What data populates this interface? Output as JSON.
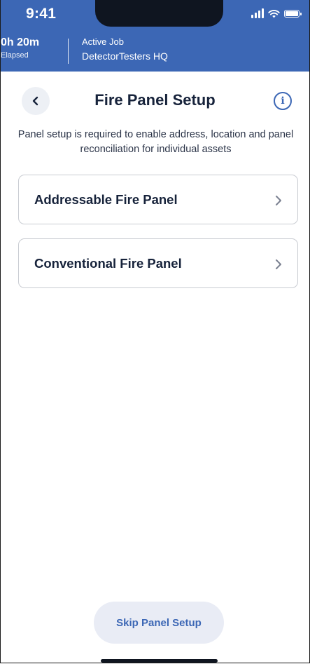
{
  "status_bar": {
    "time": "9:41",
    "icons": [
      "signal-icon",
      "wifi-icon",
      "battery-icon"
    ]
  },
  "job_header": {
    "elapsed_value": "0h 20m",
    "elapsed_label": "Elapsed",
    "active_title": "Active Job",
    "site_name": "DetectorTesters HQ"
  },
  "page": {
    "back_icon": "chevron-left-icon",
    "title": "Fire Panel Setup",
    "info_icon": "info-icon",
    "description": "Panel setup is required to enable address, location and panel reconciliation for individual assets"
  },
  "options": [
    {
      "label": "Addressable Fire Panel",
      "icon": "chevron-right-icon"
    },
    {
      "label": "Conventional Fire Panel",
      "icon": "chevron-right-icon"
    }
  ],
  "footer": {
    "skip_label": "Skip Panel Setup"
  },
  "colors": {
    "header_blue": "#3c67b5",
    "title_navy": "#17233b",
    "skip_bg": "#e9ecf5"
  }
}
